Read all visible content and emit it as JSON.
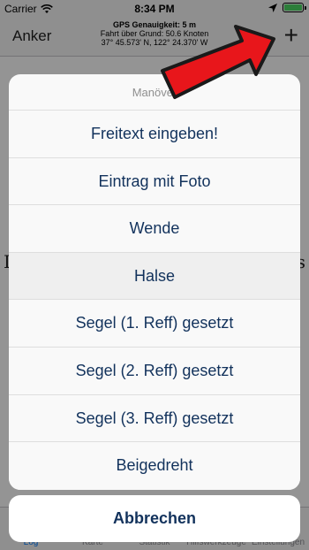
{
  "statusbar": {
    "carrier": "Carrier",
    "time": "8:34 PM"
  },
  "navbar": {
    "left_label": "Anker",
    "gps_accuracy": "GPS Genauigkeit: 5 m",
    "speed_over_ground": "Fahrt über Grund: 50.6 Knoten",
    "coordinates": "37° 45.573' N, 122° 24.370' W",
    "add_label": "+"
  },
  "tabs": [
    {
      "label": "Log"
    },
    {
      "label": "Karte"
    },
    {
      "label": "Statistik"
    },
    {
      "label": "Hilfswerkzeuge"
    },
    {
      "label": "Einstellungen"
    }
  ],
  "background_letters": {
    "left": "L",
    "right": "s"
  },
  "sheet": {
    "title": "Manöver",
    "items": [
      {
        "label": "Freitext eingeben!"
      },
      {
        "label": "Eintrag mit Foto"
      },
      {
        "label": "Wende"
      },
      {
        "label": "Halse"
      },
      {
        "label": "Segel (1. Reff) gesetzt"
      },
      {
        "label": "Segel (2. Reff) gesetzt"
      },
      {
        "label": "Segel (3. Reff) gesetzt"
      },
      {
        "label": "Beigedreht"
      }
    ],
    "cancel_label": "Abbrechen"
  },
  "colors": {
    "accent": "#12325c",
    "arrow_red": "#e8161b",
    "battery": "#4cd964"
  },
  "icons": [
    "wifi-icon",
    "location-arrow-icon",
    "battery-icon",
    "plus-icon",
    "red-arrow-annotation"
  ]
}
